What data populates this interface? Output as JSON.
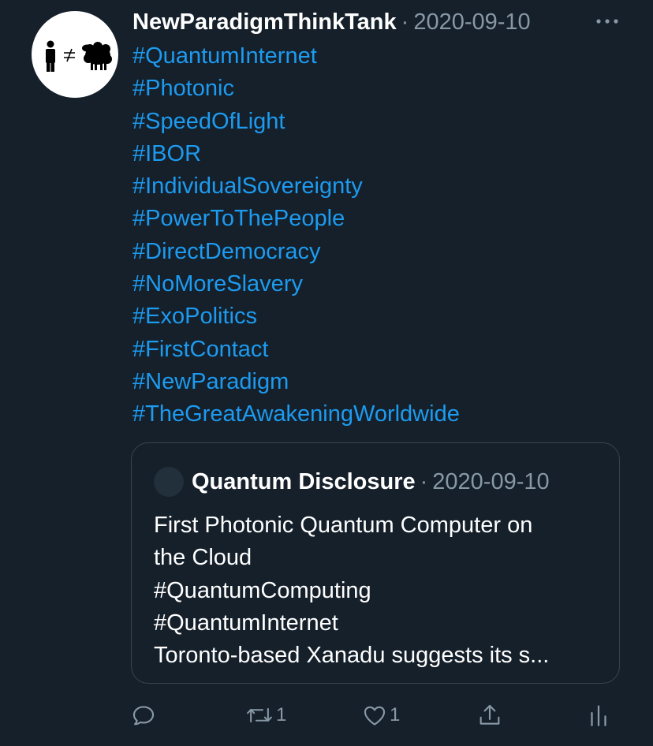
{
  "tweet": {
    "author": "NewParadigmThinkTank",
    "separator": "·",
    "date": "2020-09-10",
    "avatar_icon": "person-not-equal-sheep-icon",
    "hashtags": [
      "#QuantumInternet",
      "#Photonic",
      "#SpeedOfLight",
      "#IBOR",
      "#IndividualSovereignty",
      "#PowerToThePeople",
      "#DirectDemocracy",
      "#NoMoreSlavery",
      "#ExoPolitics",
      "#FirstContact",
      "#NewParadigm",
      "#TheGreatAwakeningWorldwide"
    ]
  },
  "quoted": {
    "author": "Quantum Disclosure",
    "separator": "·",
    "date": "2020-09-10",
    "lines": [
      "First Photonic Quantum Computer on",
      "the Cloud",
      "#QuantumComputing",
      "#QuantumInternet",
      "Toronto-based Xanadu suggests its s..."
    ]
  },
  "actions": {
    "reply_icon": "reply-icon",
    "retweet_icon": "retweet-icon",
    "retweet_count": "1",
    "like_icon": "heart-icon",
    "like_count": "1",
    "share_icon": "share-icon",
    "analytics_icon": "analytics-icon"
  },
  "colors": {
    "background": "#15202b",
    "link": "#1d9bf0",
    "muted": "#8899a6",
    "border": "#38444d"
  }
}
